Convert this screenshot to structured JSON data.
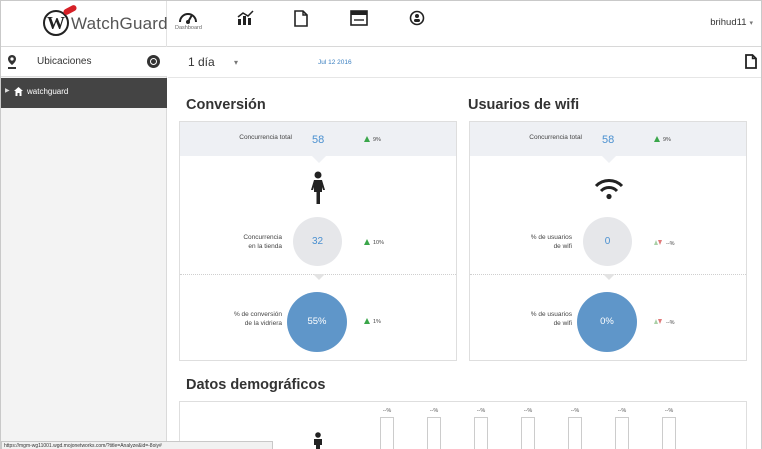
{
  "app": {
    "logo_text": "WatchGuard",
    "logo_mark": "W",
    "brand_color": "#d62027"
  },
  "topnav": {
    "items": [
      {
        "icon": "dashboard-icon",
        "caption": "Dashboard",
        "active": true
      },
      {
        "icon": "analytics-icon",
        "caption": ""
      },
      {
        "icon": "report-icon",
        "caption": ""
      },
      {
        "icon": "window-icon",
        "caption": ""
      },
      {
        "icon": "power-icon",
        "caption": ""
      }
    ],
    "user": "brihud11",
    "user_caret": "▾"
  },
  "sidebar": {
    "title": "Ubicaciones",
    "items": [
      {
        "label": "watchguard",
        "icon": "home-icon",
        "selected": true
      }
    ]
  },
  "subbar": {
    "range": "1 día",
    "range_caret": "▾",
    "date": "Jul 12 2016"
  },
  "conversion": {
    "title": "Conversión",
    "total_label": "Concurrencia total",
    "total_value": "58",
    "total_delta": "9%",
    "store_label_1": "Concurrencia",
    "store_label_2": "en la tienda",
    "store_value": "32",
    "store_delta": "10%",
    "window_label_1": "% de conversión",
    "window_label_2": "de la vidriera",
    "window_value": "55%",
    "window_delta": "1%"
  },
  "wifi": {
    "title": "Usuarios de wifi",
    "total_label": "Concurrencia total",
    "total_value": "58",
    "total_delta": "9%",
    "users_label_1": "% de usuarios",
    "users_label_2": "de wifi",
    "users_value": "0",
    "users_delta": "--%",
    "users2_label_1": "% de usuarios",
    "users2_label_2": "de wifi",
    "users2_value": "0%",
    "users2_delta": "--%"
  },
  "demographics": {
    "title": "Datos demográficos",
    "columns": [
      "--%",
      "--%",
      "--%",
      "--%",
      "--%",
      "--%",
      "--%"
    ]
  },
  "statusbar": {
    "url": "https://mgm-wg11001.wgd.mojonetworks.com/?title=Analyze&id=-8oiy#"
  }
}
